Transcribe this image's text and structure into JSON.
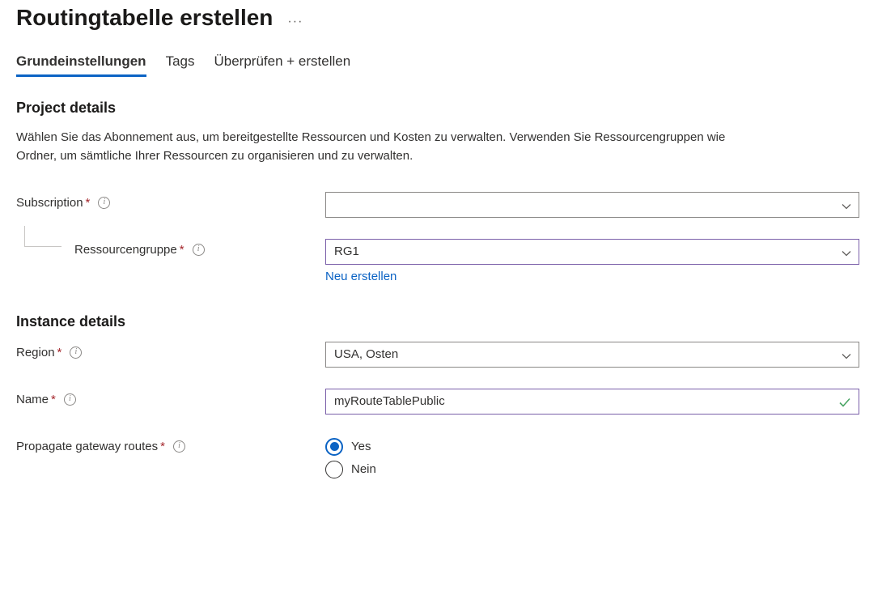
{
  "header": {
    "title": "Routingtabelle erstellen",
    "more": "···"
  },
  "tabs": {
    "basics": "Grundeinstellungen",
    "tags": "Tags",
    "review": "Überprüfen + erstellen"
  },
  "project": {
    "sectionTitle": "Project details",
    "description": "Wählen Sie das Abonnement aus, um bereitgestellte Ressourcen und Kosten zu verwalten. Verwenden Sie Ressourcengruppen wie Ordner, um sämtliche Ihrer Ressourcen zu organisieren und zu verwalten.",
    "subscriptionLabel": "Subscription",
    "subscriptionValue": "",
    "rgLabel": "Ressourcengruppe",
    "rgValue": "RG1",
    "newLink": "Neu erstellen"
  },
  "instance": {
    "sectionTitle": "Instance details",
    "regionLabel": "Region",
    "regionValue": "USA, Osten",
    "nameLabel": "Name",
    "nameValue": "myRouteTablePublic",
    "propagateLabel": "Propagate gateway routes",
    "propagateYes": "Yes",
    "propagateNo": "Nein"
  }
}
